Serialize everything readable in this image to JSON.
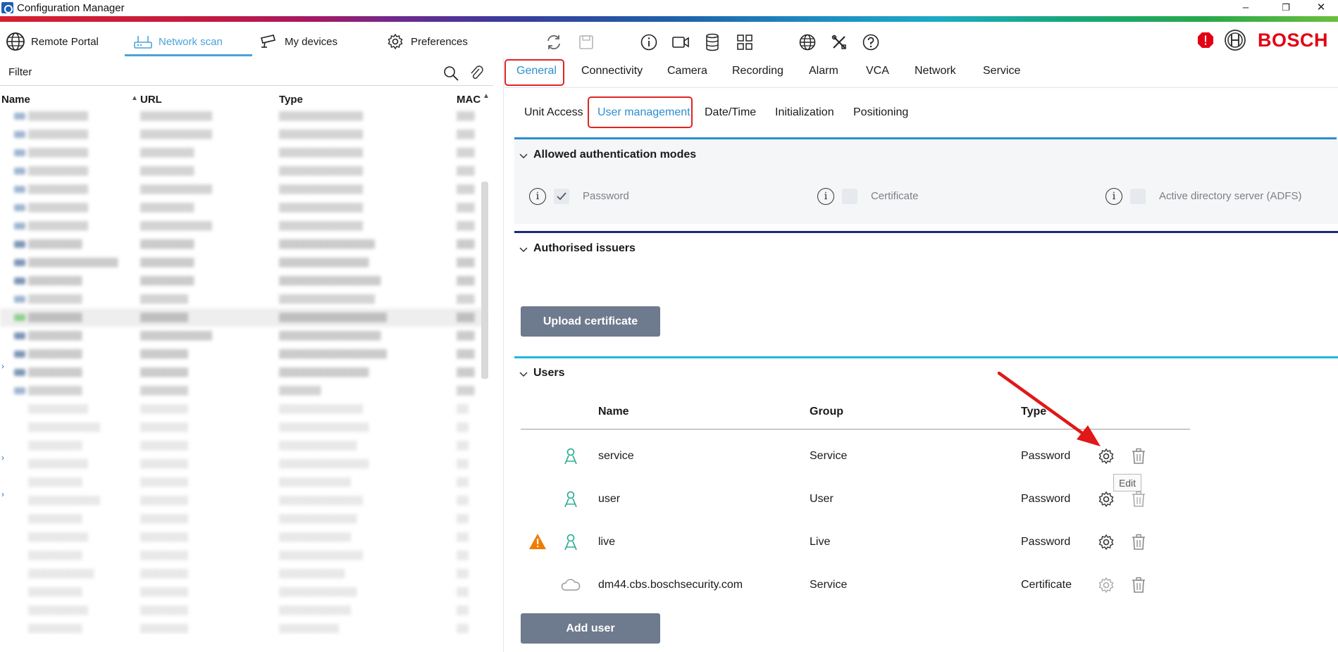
{
  "window": {
    "title": "Configuration Manager",
    "controls": [
      "–",
      "❐",
      "✕"
    ]
  },
  "nav": {
    "remote_portal": "Remote Portal",
    "network_scan": "Network scan",
    "my_devices": "My devices",
    "preferences": "Preferences"
  },
  "brand": {
    "name": "BOSCH",
    "color": "#e20015"
  },
  "left": {
    "filter_placeholder": "Filter",
    "columns": [
      "Name",
      "URL",
      "Type",
      "MAC"
    ]
  },
  "tabs": {
    "main": [
      "General",
      "Connectivity",
      "Camera",
      "Recording",
      "Alarm",
      "VCA",
      "Network",
      "Service"
    ],
    "active_main": "General",
    "sub": [
      "Unit Access",
      "User management",
      "Date/Time",
      "Initialization",
      "Positioning"
    ],
    "active_sub": "User management"
  },
  "auth_modes": {
    "title": "Allowed authentication modes",
    "password": {
      "label": "Password",
      "checked": true
    },
    "certificate": {
      "label": "Certificate",
      "checked": false
    },
    "adfs": {
      "label": "Active directory server (ADFS)",
      "checked": false
    }
  },
  "issuers": {
    "title": "Authorised issuers",
    "upload_button": "Upload certificate"
  },
  "users": {
    "title": "Users",
    "columns": {
      "name": "Name",
      "group": "Group",
      "type": "Type"
    },
    "rows": [
      {
        "name": "service",
        "group": "Service",
        "type": "Password"
      },
      {
        "name": "user",
        "group": "User",
        "type": "Password"
      },
      {
        "name": "live",
        "group": "Live",
        "type": "Password"
      },
      {
        "name": "dm44.cbs.boschsecurity.com",
        "group": "Service",
        "type": "Certificate"
      }
    ],
    "add_button": "Add user",
    "edit_tooltip": "Edit"
  },
  "colors": {
    "accent": "#2a8fd0",
    "highlight": "#e02424",
    "button": "#6e7a8d",
    "user_icon": "#1fa88f",
    "warning": "#f07d00"
  }
}
